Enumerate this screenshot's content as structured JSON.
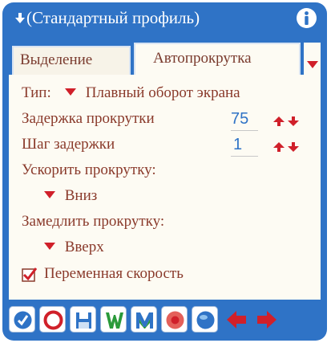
{
  "window": {
    "title": "(Стандартный профиль)",
    "colors": {
      "frame": "#2f73c6",
      "panel": "#fdfbf3",
      "text": "#8a3a2b",
      "accent_red": "#d0202a",
      "value_blue": "#2f73c6"
    }
  },
  "tabs": [
    {
      "label": "Выделение",
      "selected": false
    },
    {
      "label": "Автопрокрутка",
      "selected": true
    }
  ],
  "settings": {
    "type_label": "Тип:",
    "type_value": "Плавный оборот экрана",
    "delay_label": "Задержка прокрутки",
    "delay_value": "75",
    "step_label": "Шаг задержки",
    "step_value": "1",
    "speedup_label": "Ускорить прокрутку:",
    "speedup_value": "Вниз",
    "slowdown_label": "Замедлить прокрутку:",
    "slowdown_value": "Вверх",
    "variable_speed_label": "Переменная скорость",
    "variable_speed_checked": true
  },
  "toolbar": {
    "buttons": [
      "check-icon",
      "stop-icon",
      "save-icon",
      "w-icon",
      "m-icon",
      "record-icon",
      "globe-icon",
      "prev-icon",
      "next-icon"
    ]
  }
}
